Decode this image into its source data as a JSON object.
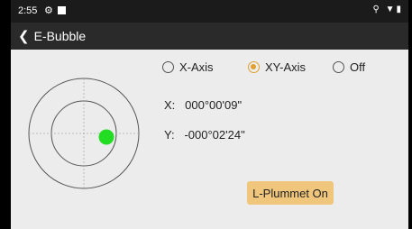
{
  "status": {
    "time": "2:55",
    "gear_icon": "⚙",
    "right_icons": "⚲ ▼▮"
  },
  "appbar": {
    "title": "E-Bubble"
  },
  "axis_modes": [
    {
      "label": "X-Axis",
      "checked": false
    },
    {
      "label": "XY-Axis",
      "checked": true
    },
    {
      "label": "Off",
      "checked": false
    }
  ],
  "readout": {
    "x_label": "X:",
    "x_value": "000°00'09\"",
    "y_label": "Y:",
    "y_value": "-000°02'24\""
  },
  "button": {
    "l_plummet": "L-Plummet On"
  },
  "colors": {
    "accent": "#e0a030",
    "bubble": "#22dd22",
    "button": "#f0c67c"
  }
}
